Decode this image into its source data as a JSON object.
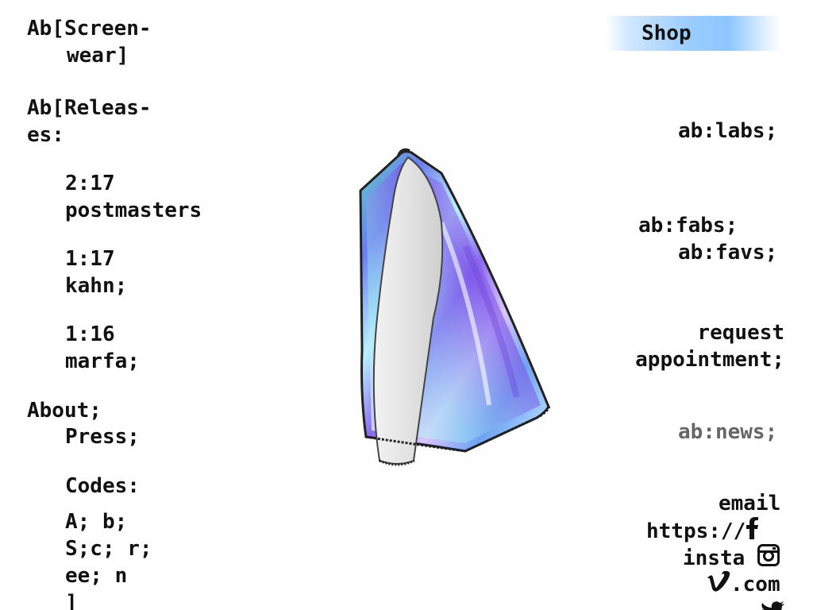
{
  "left_nav": {
    "brand_line1": "Ab[Screen-",
    "brand_line2": "wear]",
    "releases_line1": "Ab[Releas-",
    "releases_line2": "es:",
    "releases": [
      {
        "line1": "2:17",
        "line2": "postmasters;"
      },
      {
        "line1": "1:17",
        "line2": "kahn;"
      },
      {
        "line1": "1:16",
        "line2": "marfa;"
      }
    ],
    "about": "About;",
    "press": "Press;",
    "codes": "Codes:",
    "codes_lines": [
      "A; b;",
      "S;c; r;",
      "ee; n",
      "]"
    ]
  },
  "shop": {
    "label": "Shop"
  },
  "right_nav": {
    "labs": "ab:labs;",
    "fabs": "ab:fabs;",
    "favs": "ab:favs;",
    "request_line1": "request",
    "request_line2": "appointment;",
    "news": "ab:news;",
    "email": "email",
    "https": "https://",
    "insta": "insta",
    "dotcom": ".com"
  },
  "icons": {
    "facebook": "facebook-icon",
    "instagram": "instagram-icon",
    "vimeo": "vimeo-icon",
    "twitter": "twitter-icon"
  },
  "colors": {
    "text": "#111111",
    "news_text": "#666666",
    "shop_accent": "#8cc6ff"
  }
}
